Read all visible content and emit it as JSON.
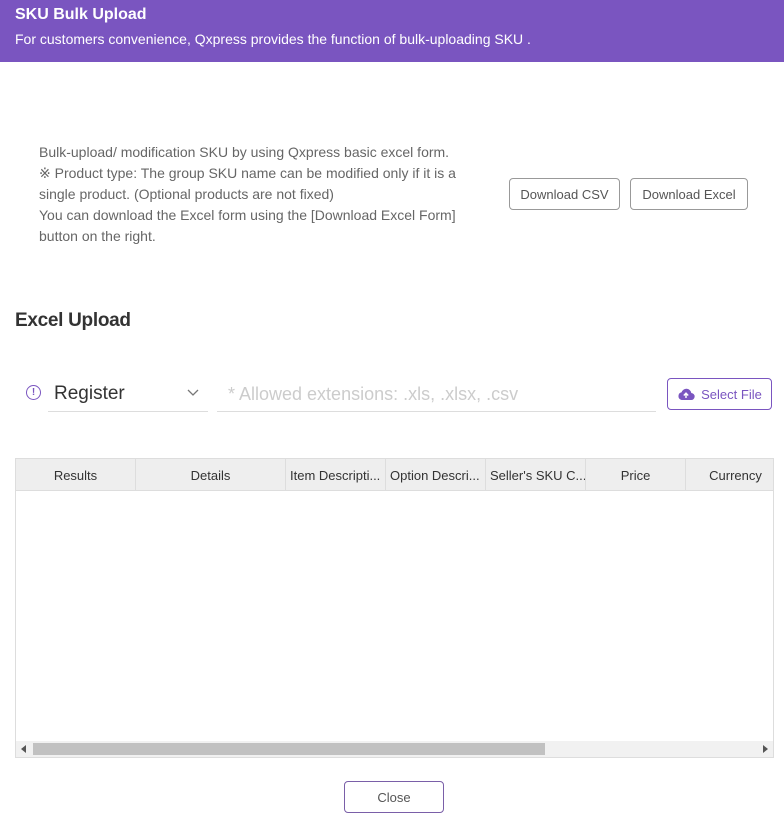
{
  "header": {
    "title": "SKU Bulk Upload",
    "subtitle": "For customers convenience, Qxpress provides the function of bulk-uploading SKU ."
  },
  "guide": {
    "lines": [
      "Bulk-upload/ modification SKU by using Qxpress basic excel form.",
      "※ Product type: The group SKU name can be modified only if it is a single product. (Optional products are not fixed)",
      "You can download the Excel form using the [Download Excel Form] button on the right."
    ]
  },
  "buttons": {
    "download_csv": "Download CSV",
    "download_excel": "Download Excel",
    "select_file": "Select File",
    "close": "Close"
  },
  "excel_upload": {
    "title": "Excel Upload",
    "mode_select_value": "Register",
    "file_placeholder": "* Allowed extensions: .xls, .xlsx, .csv",
    "info_icon": "!"
  },
  "grid": {
    "columns": [
      "Results",
      "Details",
      "Item Descripti...",
      "Option Descri...",
      "Seller's SKU C...",
      "Price",
      "Currency"
    ],
    "rows": []
  },
  "colors": {
    "accent": "#7a55c0",
    "header_bg": "#7a55c0"
  }
}
